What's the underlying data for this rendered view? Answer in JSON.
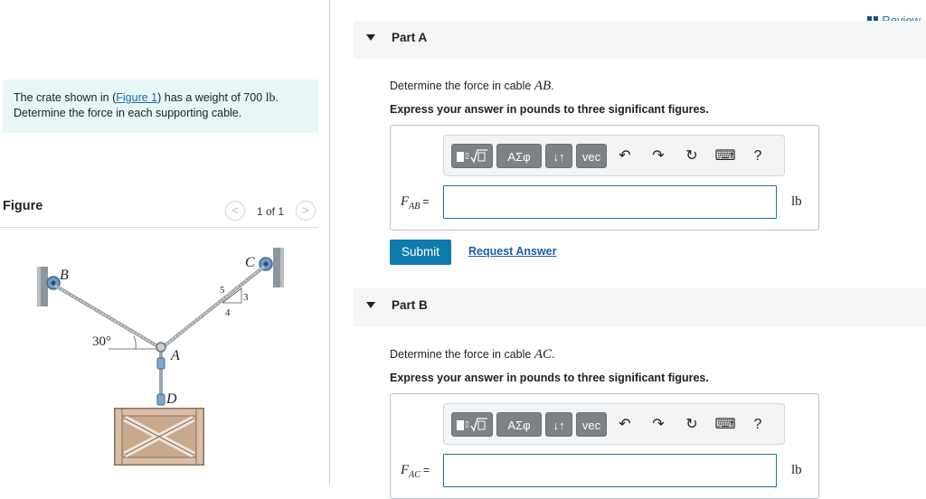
{
  "problem": {
    "text_before": "The crate shown in (",
    "figure_link": "Figure 1",
    "text_mid": ") has a weight of 700 ",
    "unit": "lb",
    "text_after": ".",
    "line2": "Determine the force in each supporting cable."
  },
  "figure_panel": {
    "title": "Figure",
    "prev_label": "<",
    "next_label": ">",
    "pager": "1 of 1",
    "labels": {
      "B": "B",
      "C": "C",
      "A": "A",
      "D": "D",
      "angle": "30°",
      "slope_5": "5",
      "slope_3": "3",
      "slope_4": "4"
    }
  },
  "review_link": "Review",
  "parts": [
    {
      "title": "Part A",
      "question_prefix": "Determine the force in cable ",
      "question_var": "AB",
      "question_suffix": ".",
      "instruction": "Express your answer in pounds to three significant figures.",
      "var_main": "F",
      "var_sub": "AB",
      "equals": "=",
      "unit": "lb",
      "input_value": ""
    },
    {
      "title": "Part B",
      "question_prefix": "Determine the force in cable ",
      "question_var": "AC",
      "question_suffix": ".",
      "instruction": "Express your answer in pounds to three significant figures.",
      "var_main": "F",
      "var_sub": "AC",
      "equals": "=",
      "unit": "lb",
      "input_value": ""
    }
  ],
  "toolbar": {
    "greek": "ΑΣφ",
    "arrows": "↓↑",
    "vec": "vec",
    "undo": "↶",
    "redo": "↷",
    "reset": "↻",
    "keyboard": "⌨",
    "help": "?"
  },
  "actions": {
    "submit": "Submit",
    "request": "Request Answer"
  }
}
